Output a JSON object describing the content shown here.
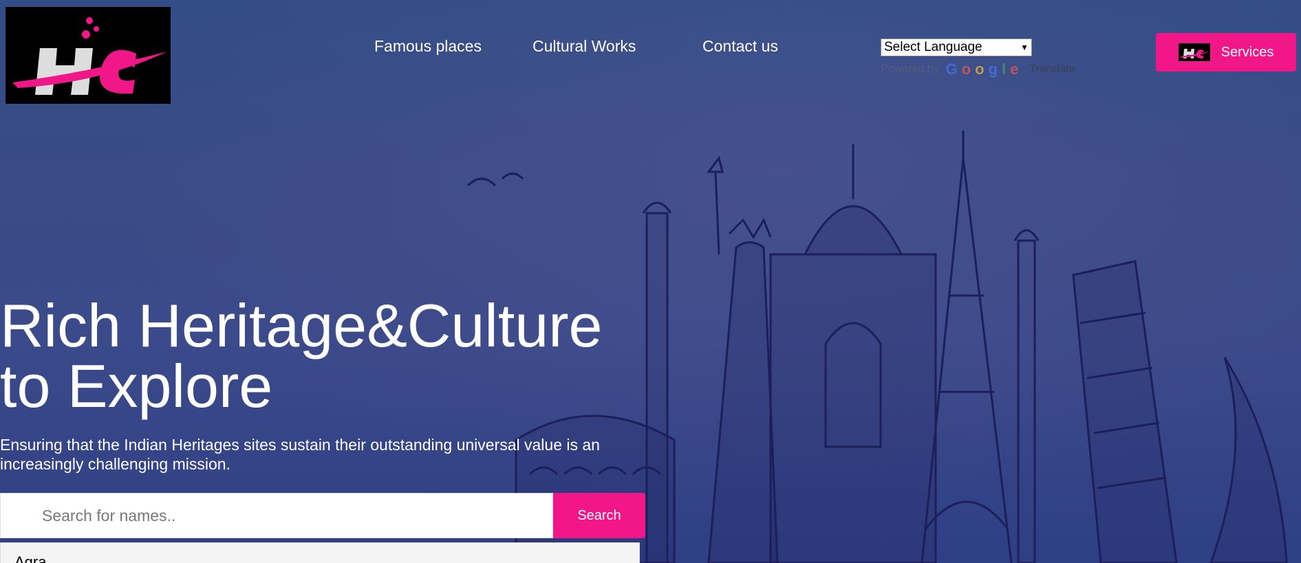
{
  "header": {
    "logo_text": "HC",
    "nav": {
      "famous": "Famous places",
      "cultural": "Cultural Works",
      "contact": "Contact us"
    },
    "language": {
      "selected": "Select Language",
      "powered_by": "Powered by",
      "google": [
        "G",
        "o",
        "o",
        "g",
        "l",
        "e"
      ],
      "translate": "Translate"
    },
    "services_label": "Services"
  },
  "hero": {
    "title_line1": "Rich Heritage&Culture",
    "title_line2": "to Explore",
    "subtitle": "Ensuring that the Indian Heritages sites sustain their outstanding universal value is an increasingly challenging mission."
  },
  "search": {
    "placeholder": "Search for names..",
    "button_label": "Search",
    "results": [
      "Agra"
    ]
  },
  "colors": {
    "accent": "#f21789",
    "background": "#3a4b86"
  }
}
